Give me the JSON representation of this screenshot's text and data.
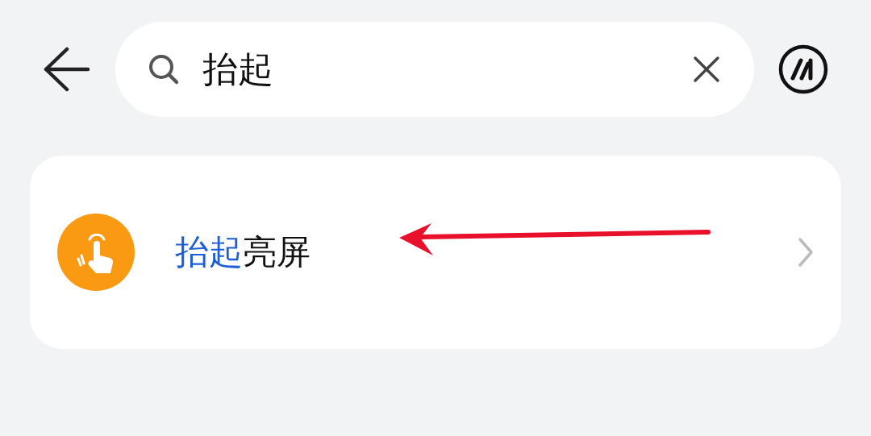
{
  "search": {
    "value": "抬起"
  },
  "results": [
    {
      "title_parts": [
        {
          "text": "抬起",
          "highlight": true
        },
        {
          "text": "亮屏",
          "highlight": false
        }
      ]
    }
  ]
}
